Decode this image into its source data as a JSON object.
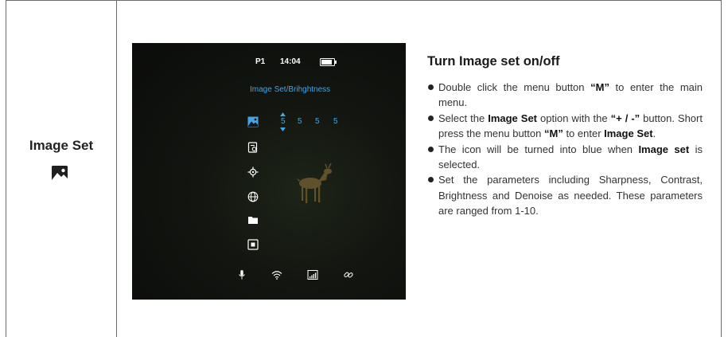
{
  "row_label": "Image Set",
  "screen": {
    "profile": "P1",
    "time": "14:04",
    "menu_title": "Image Set/Brihghtness",
    "values": [
      "5",
      "5",
      "5",
      "5"
    ],
    "accent_color": "#4aa3df",
    "menu_icons": [
      "image-set-icon",
      "settings-card-icon",
      "reticle-icon",
      "globe-icon",
      "folder-icon",
      "square-settings-icon"
    ],
    "bottom_icons": [
      "microphone-icon",
      "wifi-icon",
      "signal-bars-icon",
      "link-icon"
    ]
  },
  "instructions": {
    "heading": "Turn Image set on/off",
    "b1": {
      "t1": "Double click the menu button ",
      "q1": "“M”",
      "t2": " to enter the main menu."
    },
    "b2": {
      "t1": "Select the ",
      "s1": "Image Set",
      "t2": " option with the ",
      "s2": "“+ / -”",
      "t3": " button. Short press the menu button ",
      "s3": "“M”",
      "t4": " to enter ",
      "s4": "Image Set",
      "t5": "."
    },
    "b3": {
      "t1": "The icon will be turned into blue when ",
      "s1": "Image set",
      "t2": " is selected."
    },
    "b4": {
      "t1": "Set the parameters including Sharpness, Contrast, Brightness and Denoise as needed. These parameters are ranged from 1-10."
    }
  }
}
